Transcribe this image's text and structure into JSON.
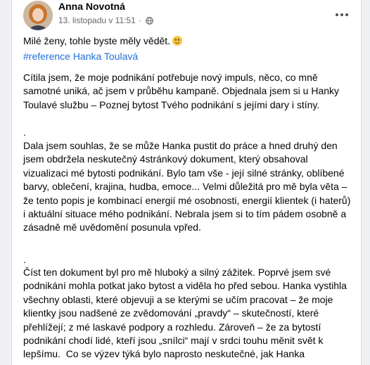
{
  "post": {
    "author": "Anna Novotná",
    "timestamp": "13. listopadu v 11:51",
    "dot": "·",
    "intro": "Milé ženy, tohle byste měly vědět.",
    "hashtag": "#reference Hanka Toulavá",
    "separator": ".",
    "paragraph1": "Cítila jsem, že moje podnikání potřebuje nový impuls, něco, co mně samotné uniká, ač jsem v průběhu kampaně. Objednala jsem si u Hanky Toulavé službu – Poznej bytost Tvého podnikání s jejími dary i stíny.",
    "paragraph2": "Dala jsem souhlas, že se může Hanka pustit do práce a hned druhý den jsem obdržela neskutečný 4stránkový dokument, který obsahoval vizualizaci mé bytosti podnikání. Bylo tam vše - její silné stránky, oblíbené barvy, oblečení, krajina, hudba, emoce... Velmi důležitá pro mě byla věta – že tento popis je kombinací energií mé osobnosti, energií klientek (i haterů) i aktuální situace mého podnikání. Nebrala jsem si to tím pádem osobně a zásadně mě uvědomění posunula vpřed.",
    "paragraph3": "Číst ten dokument byl pro mě hluboký a silný zážitek. Poprvé jsem své podnikání mohla potkat jako bytost a viděla ho před sebou. Hanka vystihla všechny oblasti, které objevuji a se kterými se učím pracovat – že moje klientky jsou nadšené ze zvědomování „pravdy“ – skutečností, které přehlížejí; z mé laskavé podpory a rozhledu. Zároveň – že za bytostí podnikání chodí lidé, kteří jsou „snílci“ mají v srdci touhu měnit svět k lepšímu.  Co se výzev týká bylo naprosto neskutečné, jak Hanka"
  },
  "icons": {
    "audience": "globe-icon",
    "more": "more-options-icon",
    "emoji": "smiling-face-icon"
  },
  "colors": {
    "hashtag": "#216fdb",
    "meta": "#65676b",
    "text": "#050505"
  }
}
